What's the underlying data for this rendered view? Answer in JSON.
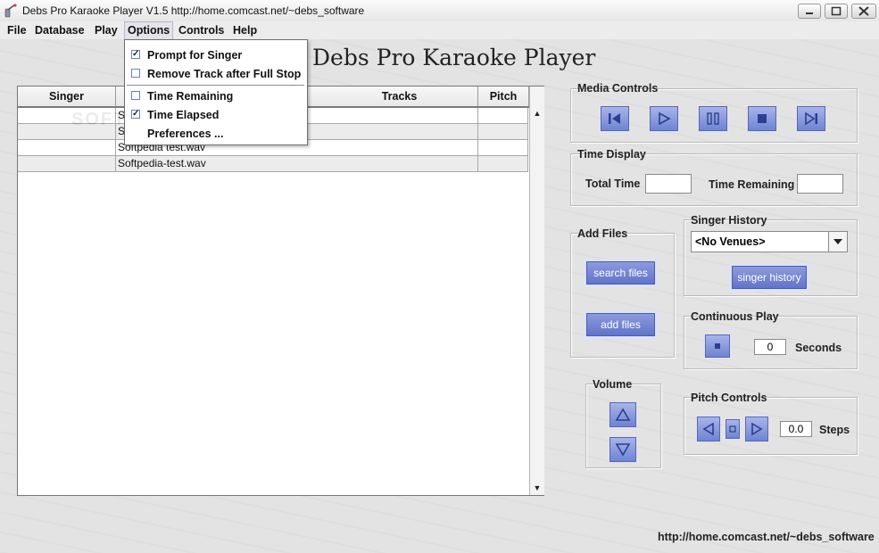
{
  "window": {
    "title": "Debs Pro Karaoke Player  V1.5  http://home.comcast.net/~debs_software"
  },
  "menubar": {
    "items": [
      {
        "label": "File"
      },
      {
        "label": "Database"
      },
      {
        "label": "Play"
      },
      {
        "label": "Options"
      },
      {
        "label": "Controls"
      },
      {
        "label": "Help"
      }
    ]
  },
  "options_menu": {
    "items": [
      {
        "label": "Prompt for Singer",
        "checked": true
      },
      {
        "label": "Remove Track after Full Stop",
        "checked": false
      },
      {
        "label": "Time Remaining",
        "checked": false
      },
      {
        "label": "Time Elapsed",
        "checked": true
      },
      {
        "label": "Preferences ..."
      }
    ]
  },
  "heading": "Debs Pro Karaoke Player",
  "table": {
    "columns": [
      "Singer",
      "Tracks",
      "Pitch"
    ],
    "rows": [
      {
        "singer": "",
        "track": "S",
        "pitch": ""
      },
      {
        "singer": "",
        "track": "S",
        "pitch": ""
      },
      {
        "singer": "",
        "track": "Softpedia test.wav",
        "pitch": ""
      },
      {
        "singer": "",
        "track": "Softpedia-test.wav",
        "pitch": ""
      }
    ]
  },
  "media_controls": {
    "title": "Media Controls",
    "buttons": [
      "skip-back-icon",
      "play-icon",
      "pause-icon",
      "stop-icon",
      "skip-forward-icon"
    ]
  },
  "time_display": {
    "title": "Time Display",
    "total_label": "Total Time",
    "total_value": "",
    "remaining_label": "Time Remaining",
    "remaining_value": ""
  },
  "add_files": {
    "title": "Add Files",
    "search_label": "search files",
    "add_label": "add  files"
  },
  "singer_history": {
    "title": "Singer History",
    "selected": "<No Venues>",
    "button_label": "singer history"
  },
  "continuous_play": {
    "title": "Continuous Play",
    "value": "0",
    "unit": "Seconds"
  },
  "volume": {
    "title": "Volume"
  },
  "pitch_controls": {
    "title": "Pitch Controls",
    "value": "0.0",
    "unit": "Steps"
  },
  "footer_url": "http://home.comcast.net/~debs_software",
  "watermark": "SOFTPEDIA",
  "colors": {
    "button_blue": "#6f83d2",
    "background": "#e3e3e3"
  }
}
